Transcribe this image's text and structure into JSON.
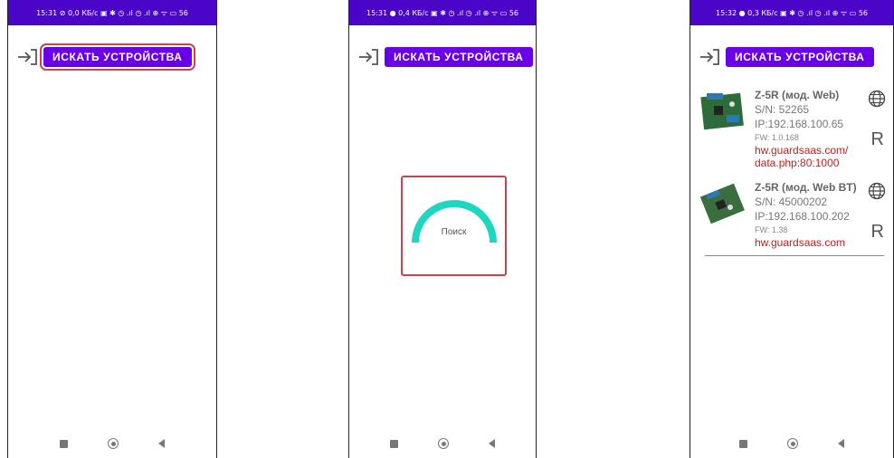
{
  "status_bars": [
    "15:31 ⊘  0,0 КБ/с ▣ ✱ ◷ .ıl ◷ .ıl ⊕ ᯤ ▭ 56",
    "15:31 ●  0,4 КБ/с ▣ ✱ ◷ .ıl ◷ .ıl ⊕ ᯤ ▭ 56",
    "15:32 ●  0,3 КБ/с ▣ ✱ ◷ .ıl ◷ .ıl ⊕ ᯤ ▭ 56"
  ],
  "scan_button_label": "ИСКАТЬ УСТРОЙСТВА",
  "search_label": "Поиск",
  "devices": [
    {
      "name": "Z-5R (мод. Web)",
      "serial": "S/N: 52265",
      "ip": "IP:192.168.100.65",
      "fw": "FW: 1.0.168",
      "link": "hw.guardsaas.com/ data.php:80:1000",
      "r_label": "R",
      "icon": "globe-icon"
    },
    {
      "name": "Z-5R (мод. Web BT)",
      "serial": "S/N: 45000202",
      "ip": "IP:192.168.100.202",
      "fw": "FW: 1.38",
      "link": "hw.guardsaas.com",
      "r_label": "R",
      "icon": "globe-icon"
    }
  ],
  "colors": {
    "status_bar": "#4b05c9",
    "button": "#6a00e8",
    "highlight": "#c8434b",
    "progress_arc": "#1ed6c2",
    "link": "#c41d1d"
  }
}
